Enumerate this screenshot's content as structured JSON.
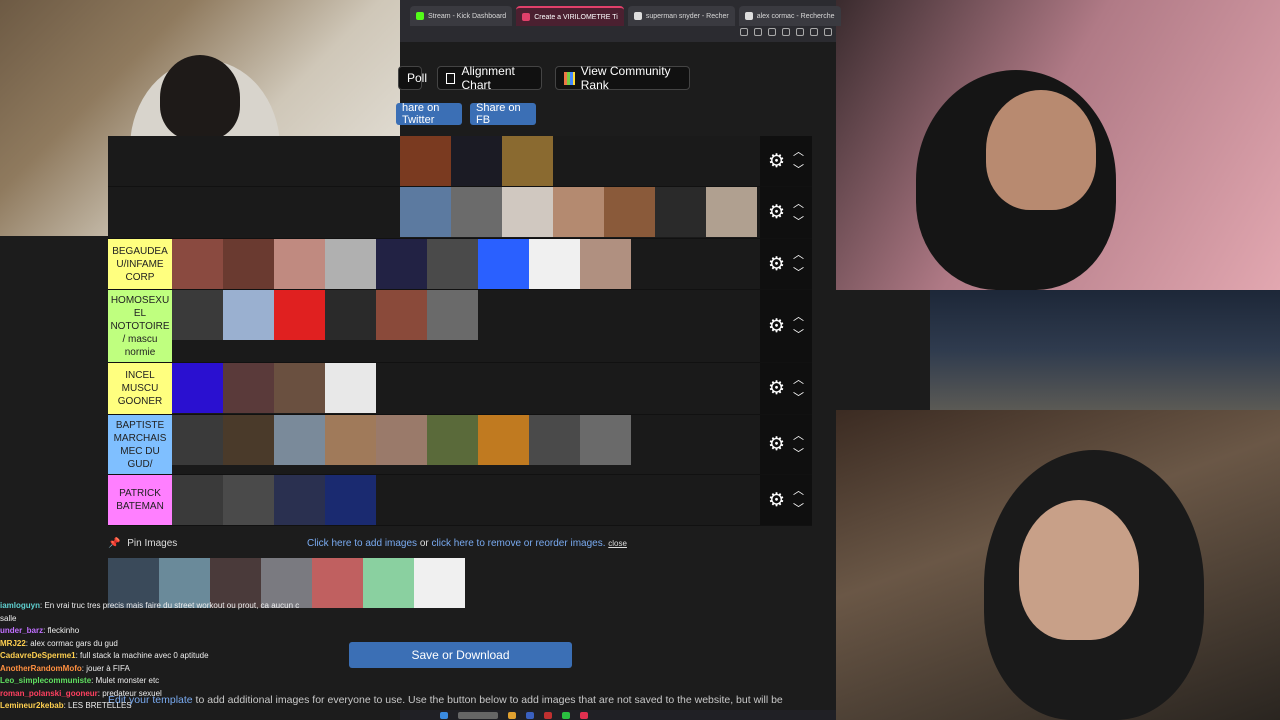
{
  "browser": {
    "tabs": [
      {
        "label": "Stream - Kick Dashboard",
        "favicon": "kick-icon",
        "color": "#53fc18",
        "active": false
      },
      {
        "label": "Create a VIRILOMETRE Ti",
        "favicon": "tierlist-icon",
        "color": "#e0406a",
        "active": true
      },
      {
        "label": "superman snyder - Recher",
        "favicon": "search-icon",
        "color": "#dddddd",
        "active": false
      },
      {
        "label": "alex cormac - Recherche",
        "favicon": "search-icon",
        "color": "#dddddd",
        "active": false
      }
    ]
  },
  "toolbar": {
    "poll_label": "Poll",
    "alignment_label": "Alignment Chart",
    "community_label": "View Community Rank",
    "twitter_label": "hare on Twitter",
    "fb_label": "Share on FB"
  },
  "tiers": [
    {
      "label": "",
      "color": "#1a1a1a",
      "count": 3,
      "colors": [
        "#7a3a20",
        "#1b1b24",
        "#8a6a30"
      ]
    },
    {
      "label": "",
      "color": "#1a1a1a",
      "count": 7,
      "colors": [
        "#5c7aa0",
        "#6b6b6b",
        "#d0c8c0",
        "#b48a70",
        "#8a5a3a",
        "#2a2a2a",
        "#b0a090"
      ]
    },
    {
      "label": "BEGAUDEA U/INFAME CORP",
      "color": "#ffff7f",
      "count": 9,
      "colors": [
        "#8a4a40",
        "#6a3a30",
        "#c08a80",
        "#b0b0b0",
        "#222244",
        "#4a4a4a",
        "#2a60ff",
        "#f0f0f0",
        "#b09080"
      ]
    },
    {
      "label": "HOMOSEXU EL NOTOTOIRE / mascu normie",
      "color": "#bfff7f",
      "count": 6,
      "colors": [
        "#3a3a3a",
        "#9ab0d0",
        "#e02020",
        "#2a2a2a",
        "#8a4a3a",
        "#6a6a6a"
      ]
    },
    {
      "label": "INCEL MUSCU GOONER",
      "color": "#ffff7f",
      "count": 4,
      "colors": [
        "#2a10d0",
        "#5a3a3a",
        "#6a5040",
        "#e8e8e8"
      ]
    },
    {
      "label": "BAPTISTE MARCHAIS MEC DU GUD/",
      "color": "#7fbfff",
      "count": 9,
      "colors": [
        "#3a3a3a",
        "#4a3a2a",
        "#7a8a9a",
        "#a07a5a",
        "#9a7a6a",
        "#5a6a3a",
        "#c07a20",
        "#4a4a4a",
        "#6a6a6a"
      ]
    },
    {
      "label": "PATRICK BATEMAN",
      "color": "#ff7fff",
      "count": 4,
      "colors": [
        "#3a3a3a",
        "#4a4a4a",
        "#2a3050",
        "#1a2a70"
      ]
    }
  ],
  "pin": {
    "title": "Pin Images",
    "add_link": "Click here to add images",
    "or_text": "or",
    "remove_link": "click here to remove or reorder images.",
    "close_label": "close",
    "images": [
      "#3a4a5a",
      "#6a8a9a",
      "#4a3a3a",
      "#7a7a80",
      "#c06060",
      "#8ad0a0",
      "#f0f0f0"
    ]
  },
  "save_label": "Save or Download",
  "footer": {
    "link": "Edit your template",
    "text": " to add additional images for everyone to use. Use the button below to add images that are not saved to the website, but will be"
  },
  "chat": [
    {
      "user": "iamloguyn",
      "color": "#5fd0d0",
      "msg": ": En vrai truc tres precis mais faire du street workout ou prout, ca aucun c"
    },
    {
      "user": "",
      "color": "#eee",
      "msg": "salle"
    },
    {
      "user": "under_barz",
      "color": "#c070ff",
      "msg": ": fleckinho"
    },
    {
      "user": "MRJ22",
      "color": "#ffd050",
      "msg": ": alex cormac gars du gud"
    },
    {
      "user": "CadavreDeSperme1",
      "color": "#ffd050",
      "msg": ": full stack la machine avec 0 aptitude"
    },
    {
      "user": "AnotherRandomMofo",
      "color": "#ff9040",
      "msg": ": jouer à FIFA"
    },
    {
      "user": "Leo_simplecommuniste",
      "color": "#60e060",
      "msg": ": Mulet monster etc"
    },
    {
      "user": "roman_polanski_gooneur",
      "color": "#ff4060",
      "msg": ": predateur sexuel"
    },
    {
      "user": "Lemineur2kebab",
      "color": "#ffd050",
      "msg": ": LES BRETELLES"
    }
  ]
}
